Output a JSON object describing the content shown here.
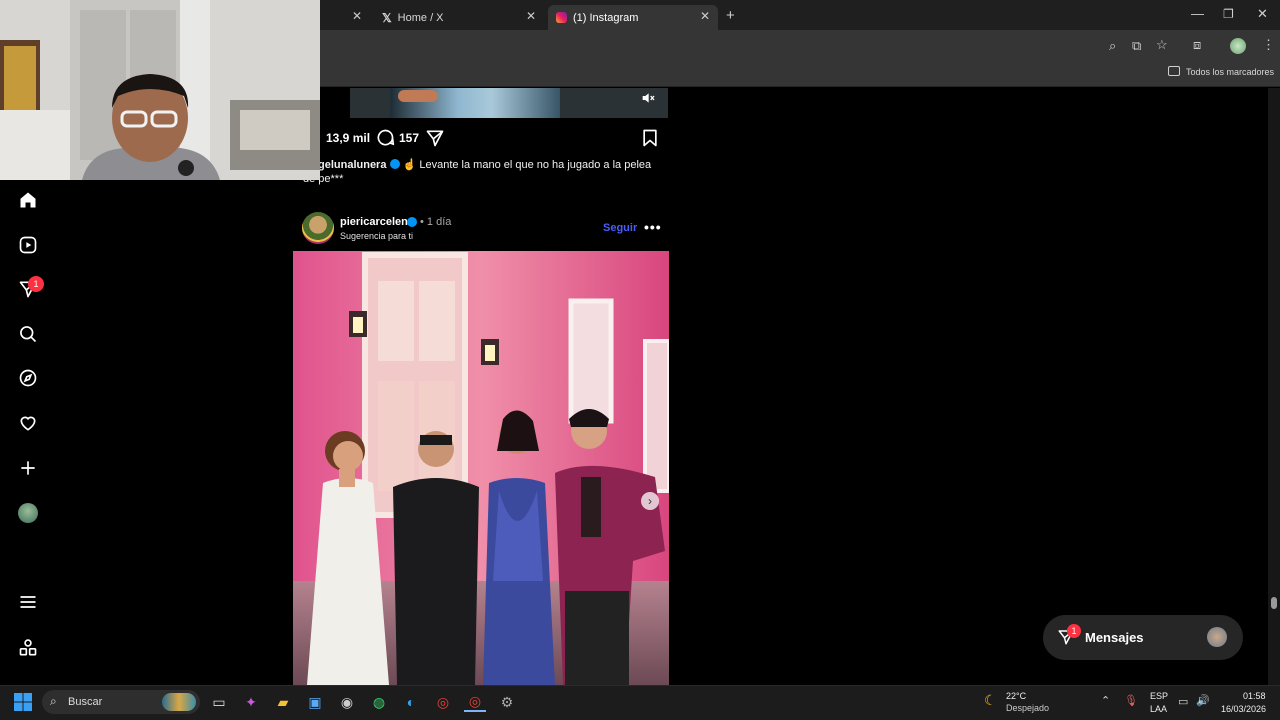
{
  "browser": {
    "tabs": [
      {
        "label": "Home / X"
      },
      {
        "label": "(1) Instagram"
      }
    ],
    "bookmarks_label": "Todos los marcadores"
  },
  "previous_post": {
    "likes": "13,9 mil",
    "comments": "157",
    "caption_user": "gelunalunera",
    "caption_text": "☝ Levante la mano el que no ha jugado a la pelea",
    "caption_cont": "de pe***"
  },
  "post": {
    "username": "piericarcelen",
    "time": "• 1 día",
    "subtitle": "Sugerencia para ti",
    "follow_label": "Seguir"
  },
  "sidebar": {
    "notif_badge": "1"
  },
  "messages": {
    "label": "Mensajes",
    "badge": "1"
  },
  "taskbar": {
    "search_placeholder": "Buscar",
    "weather_temp": "22°C",
    "weather_desc": "Despejado",
    "lang_top": "ESP",
    "lang_bottom": "LAA",
    "time": "01:58",
    "date": "16/03/2026"
  },
  "colors": {
    "accent_blue": "#4a5df9",
    "badge_red": "#ff3040",
    "verified": "#0095f6"
  }
}
